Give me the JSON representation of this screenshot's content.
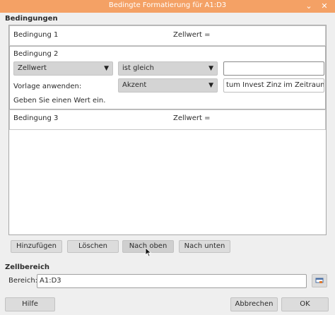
{
  "window": {
    "title": "Bedingte Formatierung für A1:D3",
    "chevron_glyph": "⌄",
    "close_glyph": "✕"
  },
  "conditions_section": {
    "label": "Bedingungen",
    "condition1": {
      "title": "Bedingung 1",
      "value_text": "Zellwert ="
    },
    "condition2": {
      "title": "Bedingung 2",
      "type_select": "Zellwert",
      "operator_select": "ist gleich",
      "value_input": "",
      "style_label": "Vorlage anwenden:",
      "style_select": "Akzent",
      "style_preview": "tum Invest Zinz im Zeitraum Sal",
      "hint": "Geben Sie einen Wert ein."
    },
    "condition3": {
      "title": "Bedingung 3",
      "value_text": "Zellwert ="
    }
  },
  "actions": {
    "add": "Hinzufügen",
    "delete": "Löschen",
    "up": "Nach oben",
    "down": "Nach unten"
  },
  "range_section": {
    "label": "Zellbereich",
    "range_label": "Bereich:",
    "range_value": "A1:D3",
    "shrink_icon": "shrink-icon"
  },
  "footer": {
    "help": "Hilfe",
    "cancel": "Abbrechen",
    "ok": "OK"
  },
  "dropdown_arrow": "▼",
  "colors": {
    "titlebar": "#f4a165",
    "button": "#dcdcdc",
    "dropdown": "#d4d4d4"
  }
}
